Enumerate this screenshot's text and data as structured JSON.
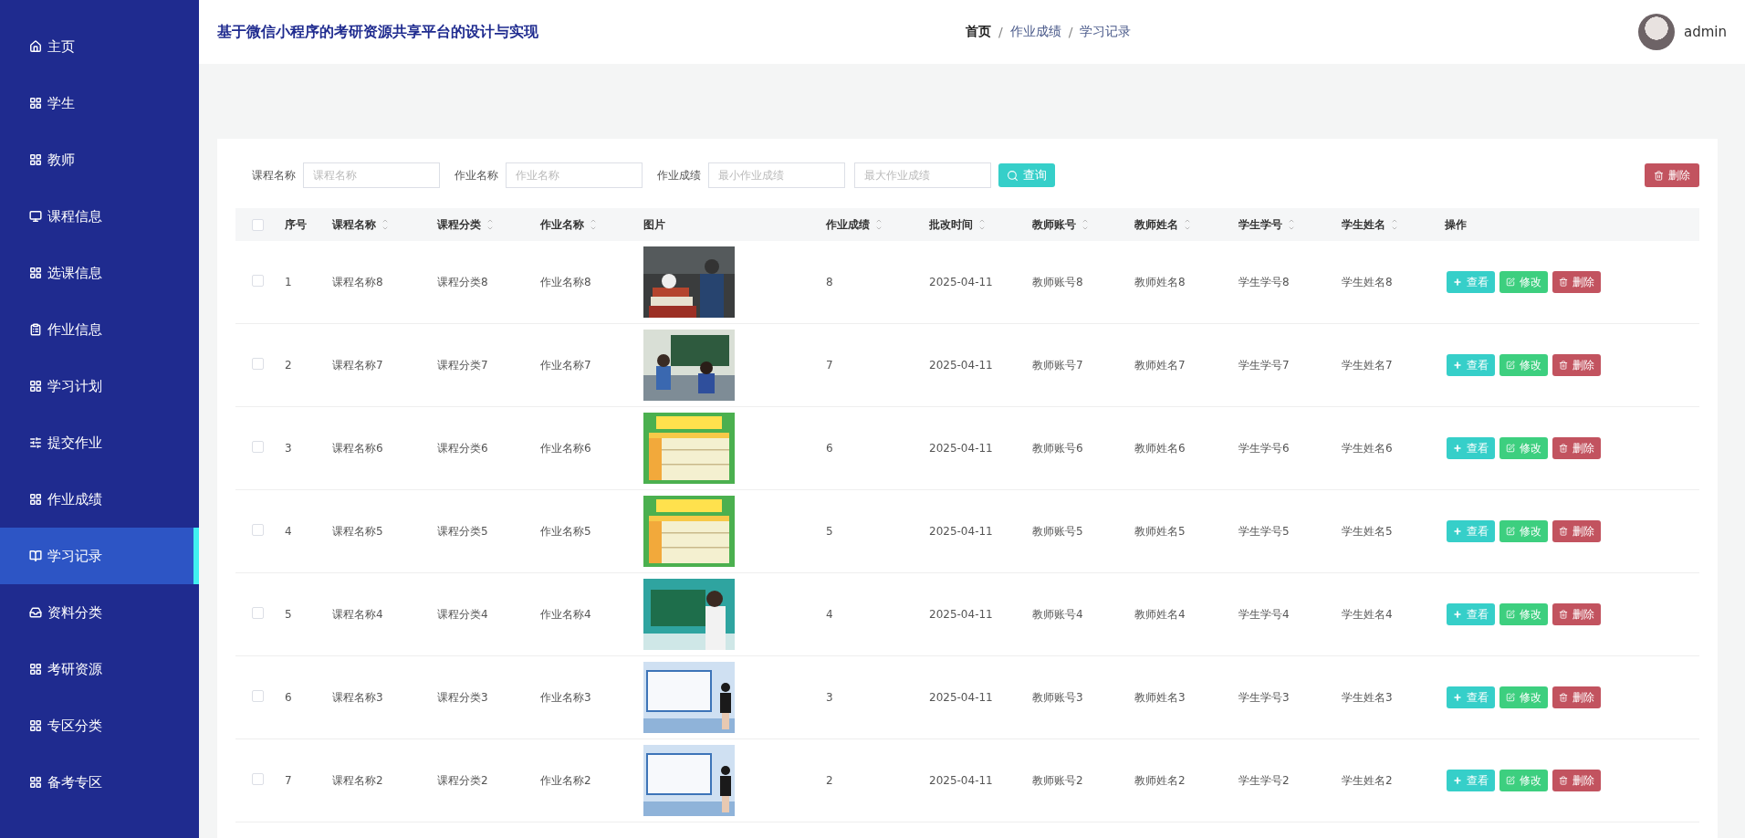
{
  "sidebar": {
    "items": [
      {
        "label": "主页",
        "selected": false
      },
      {
        "label": "学生",
        "selected": false
      },
      {
        "label": "教师",
        "selected": false
      },
      {
        "label": "课程信息",
        "selected": false
      },
      {
        "label": "选课信息",
        "selected": false
      },
      {
        "label": "作业信息",
        "selected": false
      },
      {
        "label": "学习计划",
        "selected": false
      },
      {
        "label": "提交作业",
        "selected": false
      },
      {
        "label": "作业成绩",
        "selected": false
      },
      {
        "label": "学习记录",
        "selected": true
      },
      {
        "label": "资料分类",
        "selected": false
      },
      {
        "label": "考研资源",
        "selected": false
      },
      {
        "label": "专区分类",
        "selected": false
      },
      {
        "label": "备考专区",
        "selected": false
      }
    ]
  },
  "header": {
    "title": "基于微信小程序的考研资源共享平台的设计与实现",
    "breadcrumb": [
      "首页",
      "作业成绩",
      "学习记录"
    ],
    "breadcrumb_separator": "/",
    "user": "admin"
  },
  "filters": [
    {
      "label": "课程名称",
      "inputs": [
        {
          "placeholder": "课程名称"
        }
      ]
    },
    {
      "label": "作业名称",
      "inputs": [
        {
          "placeholder": "作业名称"
        }
      ]
    },
    {
      "label": "作业成绩",
      "inputs": [
        {
          "placeholder": "最小作业成绩"
        },
        {
          "placeholder": "最大作业成绩"
        }
      ]
    }
  ],
  "search_button": "查询",
  "delete_button": "删除",
  "table": {
    "select_all": {
      "checked": false
    },
    "columns": [
      {
        "label": "序号",
        "sortable": false
      },
      {
        "label": "课程名称",
        "sortable": true
      },
      {
        "label": "课程分类",
        "sortable": true
      },
      {
        "label": "作业名称",
        "sortable": true
      },
      {
        "label": "图片",
        "sortable": false
      },
      {
        "label": "作业成绩",
        "sortable": true
      },
      {
        "label": "批改时间",
        "sortable": true
      },
      {
        "label": "教师账号",
        "sortable": true
      },
      {
        "label": "教师姓名",
        "sortable": true
      },
      {
        "label": "学生学号",
        "sortable": true
      },
      {
        "label": "学生姓名",
        "sortable": true
      },
      {
        "label": "操作",
        "sortable": false
      }
    ],
    "rows": [
      {
        "checked": false,
        "cells": [
          "1",
          "课程名称8",
          "课程分类8",
          "作业名称8",
          {
            "kind": "picture"
          },
          "8",
          "2025-04-11",
          "教师账号8",
          "教师姓名8",
          "学生学号8",
          "学生姓名8"
        ],
        "actions": [
          {
            "kind": "view",
            "label": "查看"
          },
          {
            "kind": "edit",
            "label": "修改"
          },
          {
            "kind": "delete",
            "label": "删除"
          }
        ]
      },
      {
        "checked": false,
        "cells": [
          "2",
          "课程名称7",
          "课程分类7",
          "作业名称7",
          {
            "kind": "picture"
          },
          "7",
          "2025-04-11",
          "教师账号7",
          "教师姓名7",
          "学生学号7",
          "学生姓名7"
        ],
        "actions": [
          {
            "kind": "view",
            "label": "查看"
          },
          {
            "kind": "edit",
            "label": "修改"
          },
          {
            "kind": "delete",
            "label": "删除"
          }
        ]
      },
      {
        "checked": false,
        "cells": [
          "3",
          "课程名称6",
          "课程分类6",
          "作业名称6",
          {
            "kind": "picture"
          },
          "6",
          "2025-04-11",
          "教师账号6",
          "教师姓名6",
          "学生学号6",
          "学生姓名6"
        ],
        "actions": [
          {
            "kind": "view",
            "label": "查看"
          },
          {
            "kind": "edit",
            "label": "修改"
          },
          {
            "kind": "delete",
            "label": "删除"
          }
        ]
      },
      {
        "checked": false,
        "cells": [
          "4",
          "课程名称5",
          "课程分类5",
          "作业名称5",
          {
            "kind": "picture"
          },
          "5",
          "2025-04-11",
          "教师账号5",
          "教师姓名5",
          "学生学号5",
          "学生姓名5"
        ],
        "actions": [
          {
            "kind": "view",
            "label": "查看"
          },
          {
            "kind": "edit",
            "label": "修改"
          },
          {
            "kind": "delete",
            "label": "删除"
          }
        ]
      },
      {
        "checked": false,
        "cells": [
          "5",
          "课程名称4",
          "课程分类4",
          "作业名称4",
          {
            "kind": "picture"
          },
          "4",
          "2025-04-11",
          "教师账号4",
          "教师姓名4",
          "学生学号4",
          "学生姓名4"
        ],
        "actions": [
          {
            "kind": "view",
            "label": "查看"
          },
          {
            "kind": "edit",
            "label": "修改"
          },
          {
            "kind": "delete",
            "label": "删除"
          }
        ]
      },
      {
        "checked": false,
        "cells": [
          "6",
          "课程名称3",
          "课程分类3",
          "作业名称3",
          {
            "kind": "picture"
          },
          "3",
          "2025-04-11",
          "教师账号3",
          "教师姓名3",
          "学生学号3",
          "学生姓名3"
        ],
        "actions": [
          {
            "kind": "view",
            "label": "查看"
          },
          {
            "kind": "edit",
            "label": "修改"
          },
          {
            "kind": "delete",
            "label": "删除"
          }
        ]
      },
      {
        "checked": false,
        "cells": [
          "7",
          "课程名称2",
          "课程分类2",
          "作业名称2",
          {
            "kind": "picture"
          },
          "2",
          "2025-04-11",
          "教师账号2",
          "教师姓名2",
          "学生学号2",
          "学生姓名2"
        ],
        "actions": [
          {
            "kind": "view",
            "label": "查看"
          },
          {
            "kind": "edit",
            "label": "修改"
          },
          {
            "kind": "delete",
            "label": "删除"
          }
        ]
      }
    ]
  }
}
